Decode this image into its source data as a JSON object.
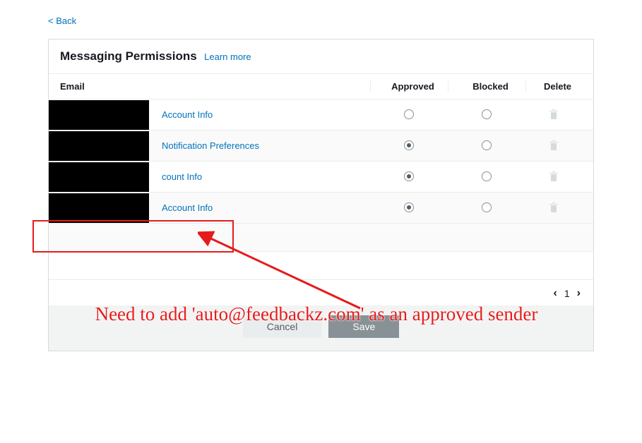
{
  "back_label": "< Back",
  "panel": {
    "title": "Messaging Permissions",
    "learn_more": "Learn more"
  },
  "columns": {
    "email": "Email",
    "approved": "Approved",
    "blocked": "Blocked",
    "delete": "Delete"
  },
  "rows": [
    {
      "link_label": "Account Info",
      "redact_width": 142,
      "approved": false,
      "blocked": false
    },
    {
      "link_label": "Notification Preferences",
      "redact_width": 142,
      "approved": true,
      "blocked": false
    },
    {
      "link_label": "count Info",
      "redact_width": 142,
      "approved": true,
      "blocked": false
    },
    {
      "link_label": "Account Info",
      "redact_width": 142,
      "approved": true,
      "blocked": false
    }
  ],
  "pagination": {
    "page": "1"
  },
  "buttons": {
    "cancel": "Cancel",
    "save": "Save"
  },
  "annotation": {
    "text": "Need to add 'auto@feedbackz.com' as an approved sender"
  }
}
